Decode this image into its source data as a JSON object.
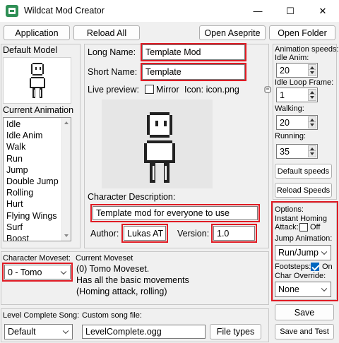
{
  "window": {
    "title": "Wildcat Mod Creator",
    "minimize_glyph": "—",
    "maximize_glyph": "☐",
    "close_glyph": "✕"
  },
  "toolbar": {
    "application": "Application",
    "reload_all": "Reload All",
    "open_aseprite": "Open Aseprite",
    "open_folder": "Open Folder"
  },
  "left": {
    "default_model_label": "Default Model",
    "current_animation_label": "Current Animation",
    "animations": [
      "Idle",
      "Idle Anim",
      "Walk",
      "Run",
      "Jump",
      "Double Jump",
      "Rolling",
      "Hurt",
      "Flying Wings",
      "Surf",
      "Boost"
    ]
  },
  "center": {
    "long_name_label": "Long Name:",
    "long_name_value": "Template Mod",
    "short_name_label": "Short Name:",
    "short_name_value": "Template",
    "live_preview_label": "Live preview:",
    "mirror_label": "Mirror",
    "icon_label": "Icon: icon.png",
    "description_label": "Character Description:",
    "description_value": "Template mod for everyone to use",
    "author_label": "Author:",
    "author_value": "Lukas AT",
    "version_label": "Version:",
    "version_value": "1.0"
  },
  "right": {
    "animation_speeds_label": "Animation speeds:",
    "idle_anim_label": "Idle Anim:",
    "idle_anim_value": "20",
    "idle_loop_label": "Idle Loop Frame:",
    "idle_loop_value": "1",
    "walking_label": "Walking:",
    "walking_value": "20",
    "running_label": "Running:",
    "running_value": "35",
    "default_speeds": "Default speeds",
    "reload_speeds": "Reload Speeds",
    "options_label": "Options:",
    "instant_homing_label": "Instant Homing",
    "attack_label": "Attack:",
    "attack_state": "Off",
    "jump_animation_label": "Jump Animation:",
    "jump_animation_value": "Run/Jump",
    "footsteps_label": "Footsteps:",
    "footsteps_state": "On",
    "char_override_label": "Char Override:",
    "char_override_value": "None",
    "save": "Save",
    "save_and_test": "Save and Test"
  },
  "moveset": {
    "character_moveset_label": "Character Moveset:",
    "moveset_value": "0 - Tomo",
    "current_moveset_label": "Current Moveset",
    "line1": "(0) Tomo Moveset.",
    "line2": "Has all the basic movements",
    "line3": "(Homing attack, rolling)"
  },
  "song": {
    "level_complete_label": "Level Complete Song:",
    "level_complete_value": "Default",
    "custom_song_label": "Custom song file:",
    "custom_song_value": "LevelComplete.ogg",
    "file_types": "File types"
  },
  "colors": {
    "highlight_red": "#e01b24",
    "accent_blue": "#0067c0"
  }
}
